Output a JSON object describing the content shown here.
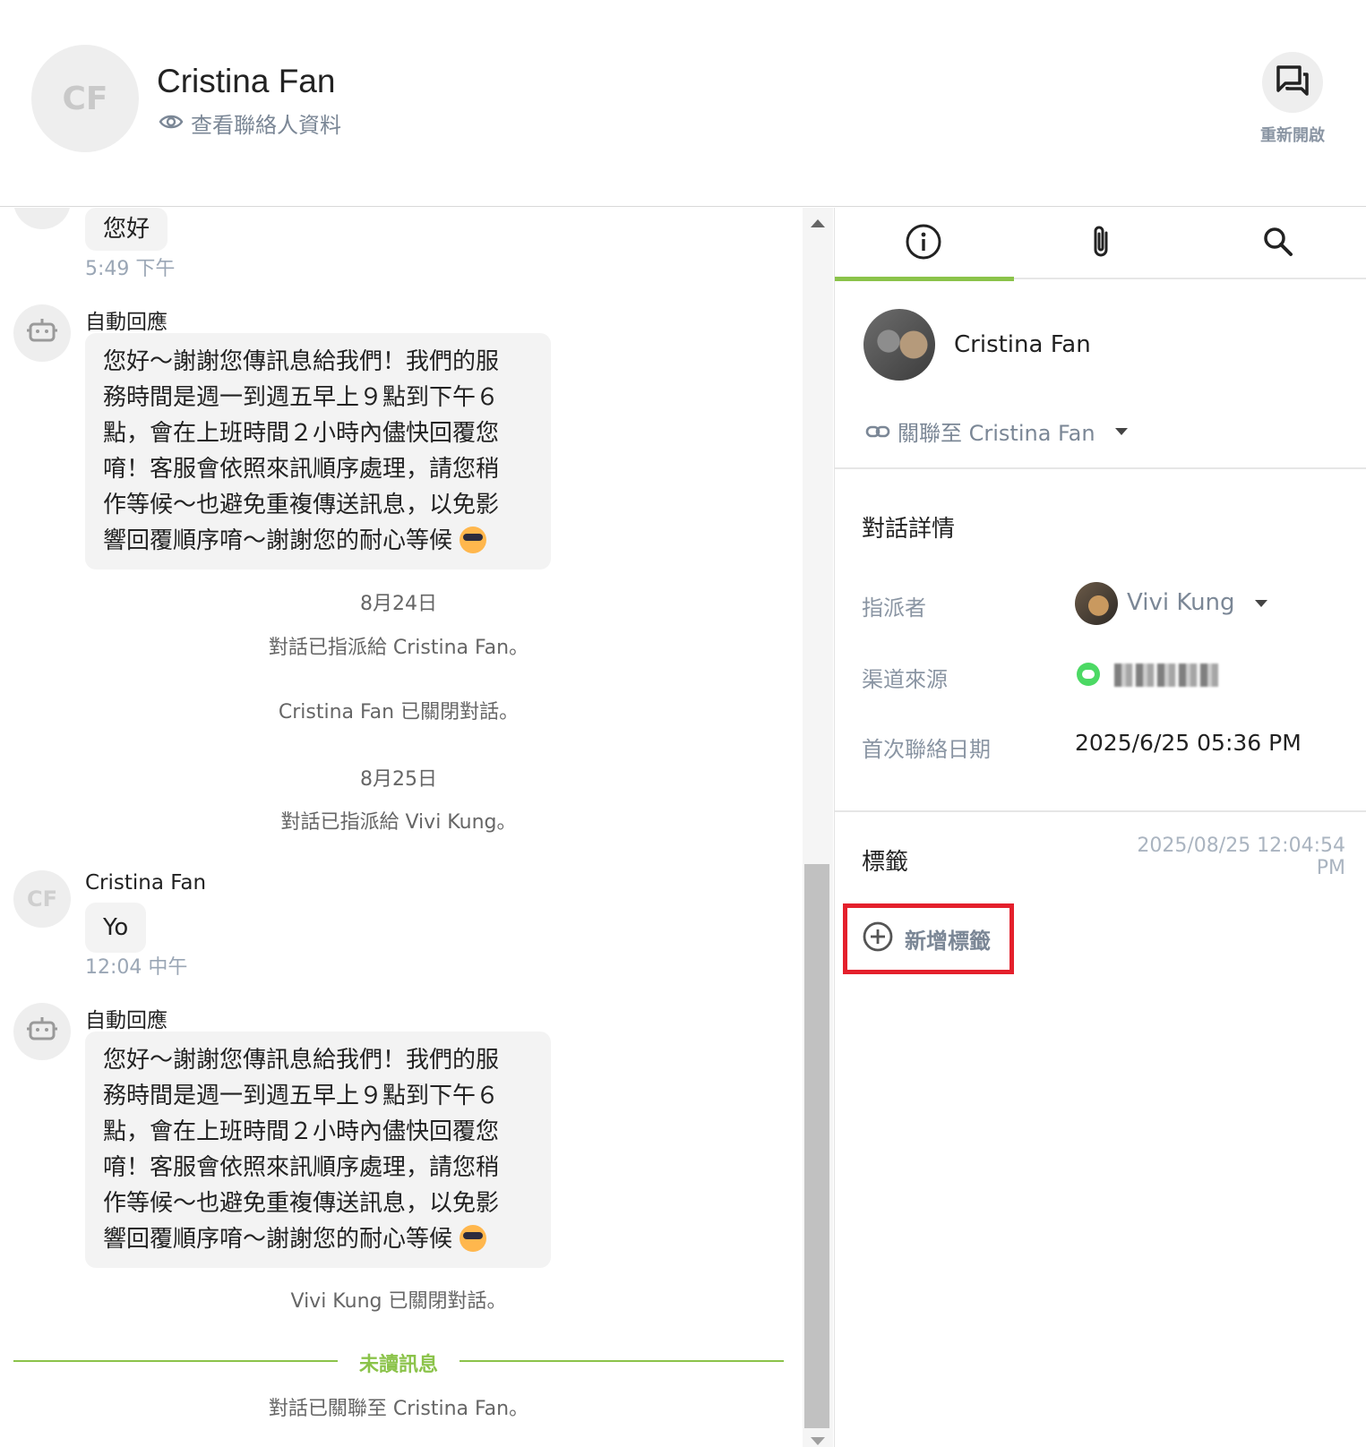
{
  "header": {
    "avatar_initials": "CF",
    "contact_name": "Cristina Fan",
    "view_contact": "查看聯絡人資料",
    "reopen_label": "重新開啟"
  },
  "chat": {
    "msg1": {
      "text": "您好",
      "time": "5:49 下午"
    },
    "auto1": {
      "sender": "自動回應",
      "lines": [
        "您好～謝謝您傳訊息給我們！我們的服",
        "務時間是週一到週五早上９點到下午６",
        "點，會在上班時間２小時內儘快回覆您",
        "唷！客服會依照來訊順序處理，請您稍",
        "作等候～也避免重複傳送訊息，以免影",
        "響回覆順序唷～謝謝您的耐心等候"
      ]
    },
    "date1": "8月24日",
    "sys1": "對話已指派給 Cristina Fan。",
    "sys2": "Cristina Fan 已關閉對話。",
    "date2": "8月25日",
    "sys3": "對話已指派給 Vivi Kung。",
    "msg2": {
      "avatar_initials": "CF",
      "sender": "Cristina Fan",
      "text": "Yo",
      "time": "12:04 中午"
    },
    "auto2": {
      "sender": "自動回應",
      "lines": [
        "您好～謝謝您傳訊息給我們！我們的服",
        "務時間是週一到週五早上９點到下午６",
        "點，會在上班時間２小時內儘快回覆您",
        "唷！客服會依照來訊順序處理，請您稍",
        "作等候～也避免重複傳送訊息，以免影",
        "響回覆順序唷～謝謝您的耐心等候"
      ]
    },
    "sys4": "Vivi Kung 已關閉對話。",
    "unread": "未讀訊息",
    "sys5": "對話已關聯至 Cristina Fan。"
  },
  "panel": {
    "tabs": [
      {
        "icon": "info-icon"
      },
      {
        "icon": "attachment-icon"
      },
      {
        "icon": "search-icon"
      }
    ],
    "contact_name": "Cristina Fan",
    "relate_link": "關聯至 Cristina Fan",
    "details_title": "對話詳情",
    "assignee_label": "指派者",
    "assignee_name": "Vivi Kung",
    "channel_label": "渠道來源",
    "first_contact_label": "首次聯絡日期",
    "first_contact_value": "2025/6/25 05:36 PM",
    "tags_title": "標籤",
    "tags_time": "2025/08/25 12:04:54 PM",
    "add_tag": "新增標籤"
  },
  "colors": {
    "accent": "#8bc34a",
    "highlight": "#e4202c",
    "muted": "#7b8796"
  }
}
